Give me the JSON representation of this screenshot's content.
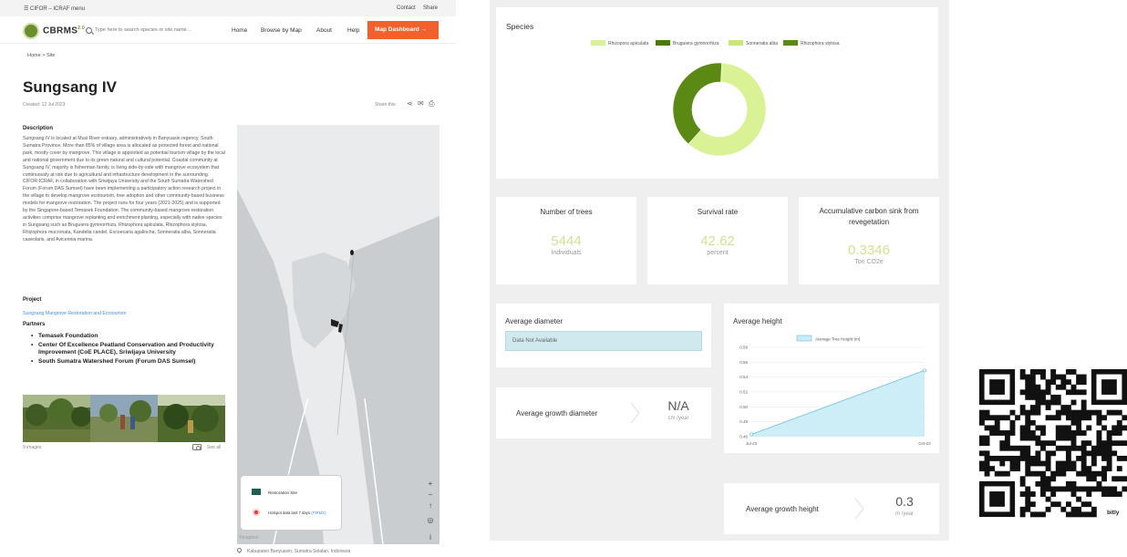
{
  "topbar": {
    "menu": "☰ CIFOR – ICRAF menu",
    "contact": "Contact",
    "share": "Share"
  },
  "navbar": {
    "logo": "CBRMS",
    "logo_sup": "2.0",
    "search_placeholder": "Type here to search species or site name...",
    "links": [
      "Home",
      "Browse by Map",
      "About",
      "Help"
    ],
    "map_dashboard": "Map Dashboard →"
  },
  "breadcrumb": "Home  >  Site",
  "site": {
    "title": "Sungsang IV",
    "created": "Created: 12 Jul 2023",
    "share_this": "Share this:",
    "description_heading": "Description",
    "description": "Sungsang IV is located at Musi River estuary, administratively in Banyuasin regency, South Sumatra Province. More than 85% of village area is allocated as protected forest and national park, mostly cover by mangrove. This village is appointed as potential tourism village by the local and national government due to its green natural and cultural potential. Coastal community at Sungsang IV, majority is fisherman family, is living side-by-side with mangrove ecosystem that continuously at risk due to agricultural and infrastructure development in the surrounding. CIFOR-ICRAF, in collaboration with Sriwijaya University and the South Sumatra Watershed Forum (Forum DAS Sumsel) have been implementing a participatory action research project in the village to develop mangrove ecotourism, tree adoption and other community-based business models for mangrove restoration. The project runs for four years (2021-2025) and is supported by the Singapore-based Temasek Foundation. The community-based mangrove restoration activities comprise mangrove replanting and enrichment planting, especially with native species in Sungsang such as Bruguiera gymnorrhiza, Rhizophora apiculata, Rhizophora stylosa, Rhizophora mucronata, Kandelia candel, Excoecaria agallocha, Sonneratia alba, Sonneratia caseolaris, and Avicennia marina.",
    "project_heading": "Project",
    "project_link": "Sungsang Mangrove Restoration and Ecotourism",
    "partners_heading": "Partners",
    "partners": [
      "Temasek Foundation",
      "Center Of Excellence Peatland Conservation and Productivity Improvement (CoE PLACE), Sriwijaya University",
      "South Sumatra Watershed Forum (Forum DAS Sumsel)"
    ],
    "images_count": "9 images",
    "see_all": "See all",
    "location": "Kabupaten Banyuasin, Sumatra Selatan, Indonesia"
  },
  "map": {
    "legend_restoration": "Restoration Site",
    "legend_hotspot": "Hotspot data last 7 days ",
    "legend_hotspot_link": "(FIRMS)",
    "attribution": "©mapbox",
    "controls": [
      "+",
      "−",
      "↑",
      "◎",
      "i"
    ],
    "colors": {
      "water": "#e9ebec",
      "land": "#c9cdd0",
      "site": "#1f5f52"
    }
  },
  "dashboard": {
    "species": {
      "title": "Species",
      "legend": [
        "Rhizopora apiculata",
        "Bruguiera gymnorrhiza",
        "Sonneratia alba",
        "Rhizophora stylosa"
      ]
    },
    "number_of_trees": {
      "title": "Number of trees",
      "value": "5444",
      "unit": "Individuals"
    },
    "survival_rate": {
      "title": "Survival rate",
      "value": "42.62",
      "unit": "percent"
    },
    "carbon_sink": {
      "title": "Accumulative carbon sink from revegetation",
      "value": "0.3346",
      "unit": "Ton CO2e"
    },
    "average_diameter": {
      "title": "Average diameter",
      "value": "Data Not Available"
    },
    "average_growth_diameter": {
      "title": "Average growth diameter",
      "value": "N/A",
      "unit": "cm /year"
    },
    "average_height": {
      "title": "Average height"
    },
    "average_growth_height": {
      "title": "Average growth height",
      "value": "0.3",
      "unit": "m /year"
    }
  },
  "qr_label": "bitly",
  "chart_data": [
    {
      "type": "pie",
      "title": "Species",
      "categories": [
        "Rhizopora apiculata",
        "Bruguiera gymnorrhiza",
        "Sonneratia alba",
        "Rhizophora stylosa"
      ],
      "values": [
        59,
        0,
        0,
        38
      ],
      "colors": [
        "#d9f296",
        "#4a7a0a",
        "#c7e879",
        "#5a8a14"
      ],
      "donut": true,
      "legend_position": "top"
    },
    {
      "type": "area",
      "title": "",
      "x": [
        "Jul-23",
        "Oct-23"
      ],
      "series": [
        {
          "name": "Average Tree Height (m)",
          "values": [
            0.463,
            0.549
          ]
        }
      ],
      "y_ticks": [
        0.46,
        0.48,
        0.5,
        0.52,
        0.54,
        0.56,
        0.58
      ],
      "ylim": [
        0.46,
        0.58
      ],
      "grid": true,
      "legend_position": "top",
      "colors": {
        "fill": "#c9ecf6",
        "line": "#7ec6de"
      }
    }
  ]
}
